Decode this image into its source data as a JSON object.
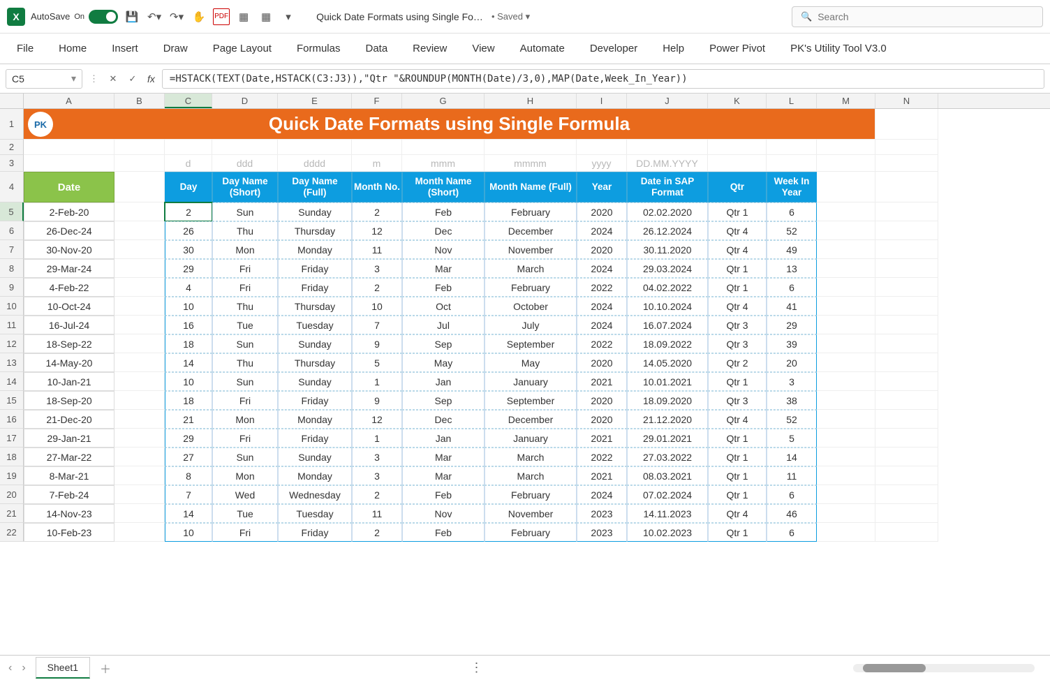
{
  "titlebar": {
    "autosave_label": "AutoSave",
    "autosave_state": "On",
    "doc_title": "Quick Date Formats using Single Fo…",
    "saved_label": "• Saved",
    "search_placeholder": "Search"
  },
  "ribbon": [
    "File",
    "Home",
    "Insert",
    "Draw",
    "Page Layout",
    "Formulas",
    "Data",
    "Review",
    "View",
    "Automate",
    "Developer",
    "Help",
    "Power Pivot",
    "PK's Utility Tool V3.0"
  ],
  "namebox": "C5",
  "formula": "=HSTACK(TEXT(Date,HSTACK(C3:J3)),\"Qtr \"&ROUNDUP(MONTH(Date)/3,0),MAP(Date,Week_In_Year))",
  "columns": [
    "A",
    "B",
    "C",
    "D",
    "E",
    "F",
    "G",
    "H",
    "I",
    "J",
    "K",
    "L",
    "M",
    "N"
  ],
  "banner_title": "Quick Date Formats using Single Formula",
  "date_header": "Date",
  "hints": [
    "d",
    "ddd",
    "dddd",
    "m",
    "mmm",
    "mmmm",
    "yyyy",
    "DD.MM.YYYY"
  ],
  "table_headers": [
    "Day",
    "Day Name (Short)",
    "Day Name (Full)",
    "Month No.",
    "Month Name (Short)",
    "Month Name (Full)",
    "Year",
    "Date in SAP Format",
    "Qtr",
    "Week In Year"
  ],
  "dates": [
    "2-Feb-20",
    "26-Dec-24",
    "30-Nov-20",
    "29-Mar-24",
    "4-Feb-22",
    "10-Oct-24",
    "16-Jul-24",
    "18-Sep-22",
    "14-May-20",
    "10-Jan-21",
    "18-Sep-20",
    "21-Dec-20",
    "29-Jan-21",
    "27-Mar-22",
    "8-Mar-21",
    "7-Feb-24",
    "14-Nov-23",
    "10-Feb-23"
  ],
  "table_rows": [
    [
      "2",
      "Sun",
      "Sunday",
      "2",
      "Feb",
      "February",
      "2020",
      "02.02.2020",
      "Qtr 1",
      "6"
    ],
    [
      "26",
      "Thu",
      "Thursday",
      "12",
      "Dec",
      "December",
      "2024",
      "26.12.2024",
      "Qtr 4",
      "52"
    ],
    [
      "30",
      "Mon",
      "Monday",
      "11",
      "Nov",
      "November",
      "2020",
      "30.11.2020",
      "Qtr 4",
      "49"
    ],
    [
      "29",
      "Fri",
      "Friday",
      "3",
      "Mar",
      "March",
      "2024",
      "29.03.2024",
      "Qtr 1",
      "13"
    ],
    [
      "4",
      "Fri",
      "Friday",
      "2",
      "Feb",
      "February",
      "2022",
      "04.02.2022",
      "Qtr 1",
      "6"
    ],
    [
      "10",
      "Thu",
      "Thursday",
      "10",
      "Oct",
      "October",
      "2024",
      "10.10.2024",
      "Qtr 4",
      "41"
    ],
    [
      "16",
      "Tue",
      "Tuesday",
      "7",
      "Jul",
      "July",
      "2024",
      "16.07.2024",
      "Qtr 3",
      "29"
    ],
    [
      "18",
      "Sun",
      "Sunday",
      "9",
      "Sep",
      "September",
      "2022",
      "18.09.2022",
      "Qtr 3",
      "39"
    ],
    [
      "14",
      "Thu",
      "Thursday",
      "5",
      "May",
      "May",
      "2020",
      "14.05.2020",
      "Qtr 2",
      "20"
    ],
    [
      "10",
      "Sun",
      "Sunday",
      "1",
      "Jan",
      "January",
      "2021",
      "10.01.2021",
      "Qtr 1",
      "3"
    ],
    [
      "18",
      "Fri",
      "Friday",
      "9",
      "Sep",
      "September",
      "2020",
      "18.09.2020",
      "Qtr 3",
      "38"
    ],
    [
      "21",
      "Mon",
      "Monday",
      "12",
      "Dec",
      "December",
      "2020",
      "21.12.2020",
      "Qtr 4",
      "52"
    ],
    [
      "29",
      "Fri",
      "Friday",
      "1",
      "Jan",
      "January",
      "2021",
      "29.01.2021",
      "Qtr 1",
      "5"
    ],
    [
      "27",
      "Sun",
      "Sunday",
      "3",
      "Mar",
      "March",
      "2022",
      "27.03.2022",
      "Qtr 1",
      "14"
    ],
    [
      "8",
      "Mon",
      "Monday",
      "3",
      "Mar",
      "March",
      "2021",
      "08.03.2021",
      "Qtr 1",
      "11"
    ],
    [
      "7",
      "Wed",
      "Wednesday",
      "2",
      "Feb",
      "February",
      "2024",
      "07.02.2024",
      "Qtr 1",
      "6"
    ],
    [
      "14",
      "Tue",
      "Tuesday",
      "11",
      "Nov",
      "November",
      "2023",
      "14.11.2023",
      "Qtr 4",
      "46"
    ],
    [
      "10",
      "Fri",
      "Friday",
      "2",
      "Feb",
      "February",
      "2023",
      "10.02.2023",
      "Qtr 1",
      "6"
    ]
  ],
  "sheet_tab": "Sheet1"
}
